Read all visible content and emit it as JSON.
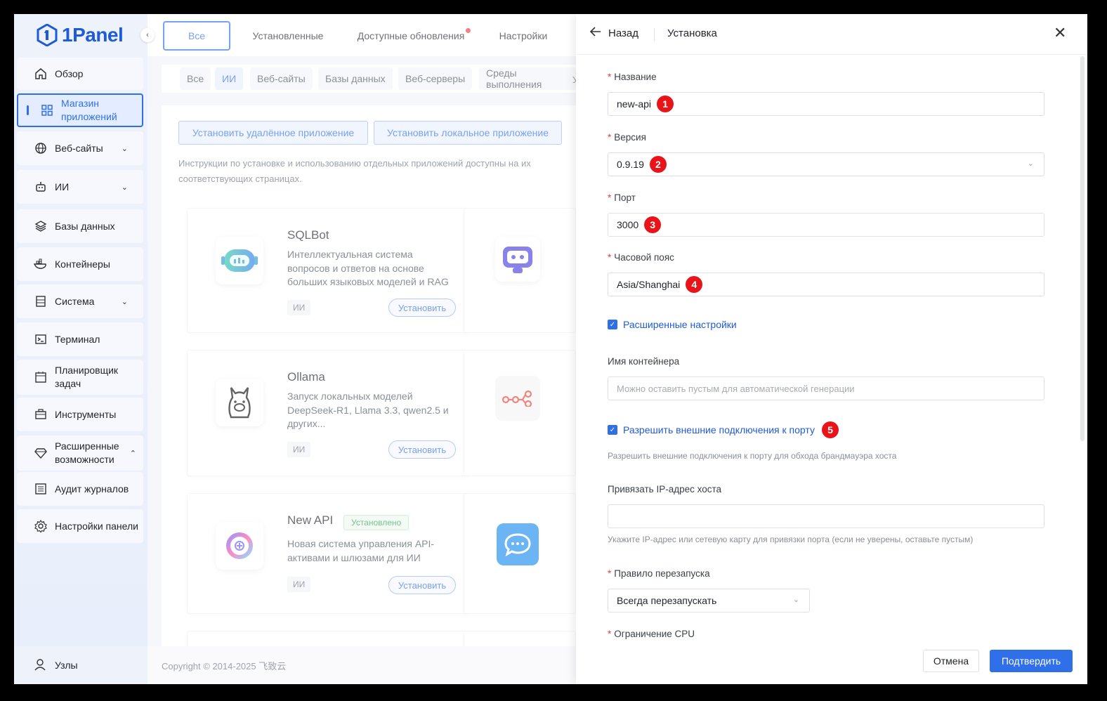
{
  "brand": {
    "name": "1Panel"
  },
  "sidebar": {
    "items": [
      {
        "label": "Обзор",
        "icon": "home-icon"
      },
      {
        "label": "Магазин приложений",
        "icon": "apps-grid-icon",
        "active": true
      },
      {
        "label": "Веб-сайты",
        "icon": "globe-icon",
        "expandable": true
      },
      {
        "label": "ИИ",
        "icon": "robot-icon",
        "expandable": true
      },
      {
        "label": "Базы данных",
        "icon": "layers-icon"
      },
      {
        "label": "Контейнеры",
        "icon": "docker-icon"
      },
      {
        "label": "Система",
        "icon": "server-icon",
        "expandable": true
      },
      {
        "label": "Терминал",
        "icon": "terminal-icon"
      },
      {
        "label": "Планировщик задач",
        "icon": "calendar-icon"
      },
      {
        "label": "Инструменты",
        "icon": "toolbox-icon"
      },
      {
        "label": "Расширенные возможности",
        "icon": "diamond-icon",
        "expandable": true
      },
      {
        "label": "Аудит журналов",
        "icon": "list-icon"
      },
      {
        "label": "Настройки панели",
        "icon": "gear-icon"
      }
    ],
    "footer": {
      "label": "Узлы",
      "icon": "user-icon"
    }
  },
  "top_tabs": [
    "Все",
    "Установленные",
    "Доступные обновления",
    "Настройки"
  ],
  "categories": [
    "Все",
    "ИИ",
    "Веб-сайты",
    "Базы данных",
    "Веб-серверы",
    "Среды выполнения"
  ],
  "categories_overflow": "Ут",
  "actions": {
    "install_remote": "Установить удалённое приложение",
    "install_local": "Установить локальное приложение"
  },
  "info_text": "Инструкции по установке и использованию отдельных приложений доступны на их соответствующих страницах.",
  "apps": [
    {
      "name": "SQLBot",
      "description": "Интеллектуальная система вопросов и ответов на основе больших языковых моделей и RAG",
      "tag": "ИИ",
      "install": "Установить"
    },
    {
      "name": "Ollama",
      "description": "Запуск локальных моделей DeepSeek-R1, Llama 3.3, qwen2.5 и других...",
      "tag": "ИИ",
      "install": "Установить"
    },
    {
      "name": "New API",
      "badge": "Установлено",
      "description": "Новая система управления API-активами и шлюзами для ИИ",
      "tag": "ИИ",
      "install": "Установить"
    }
  ],
  "footer": {
    "copyright": "Copyright © 2014-2025 飞致云"
  },
  "drawer": {
    "back": "Назад",
    "title": "Установка",
    "fields": {
      "name": {
        "label": "Название",
        "value": "new-api",
        "marker": "1"
      },
      "version": {
        "label": "Версия",
        "value": "0.9.19",
        "marker": "2"
      },
      "port": {
        "label": "Порт",
        "value": "3000",
        "marker": "3"
      },
      "timezone": {
        "label": "Часовой пояс",
        "value": "Asia/Shanghai",
        "marker": "4"
      },
      "advanced": {
        "label": "Расширенные настройки",
        "checked": true
      },
      "container_name": {
        "label": "Имя контейнера",
        "placeholder": "Можно оставить пустым для автоматической генерации"
      },
      "external": {
        "label": "Разрешить внешние подключения к порту",
        "marker": "5",
        "checked": true,
        "hint": "Разрешить внешние подключения к порту для обхода брандмауэра хоста"
      },
      "host_ip": {
        "label": "Привязать IP-адрес хоста",
        "value": "",
        "hint": "Укажите IP-адрес или сетевую карту для привязки порта (если не уверены, оставьте пустым)"
      },
      "restart": {
        "label": "Правило перезапуска",
        "value": "Всегда перезапускать"
      },
      "cpu": {
        "label": "Ограничение CPU"
      }
    },
    "cancel": "Отмена",
    "confirm": "Подтвердить"
  },
  "colors": {
    "accent": "#2f6fea",
    "marker": "#e8141a",
    "installed": "#2ea44f"
  }
}
